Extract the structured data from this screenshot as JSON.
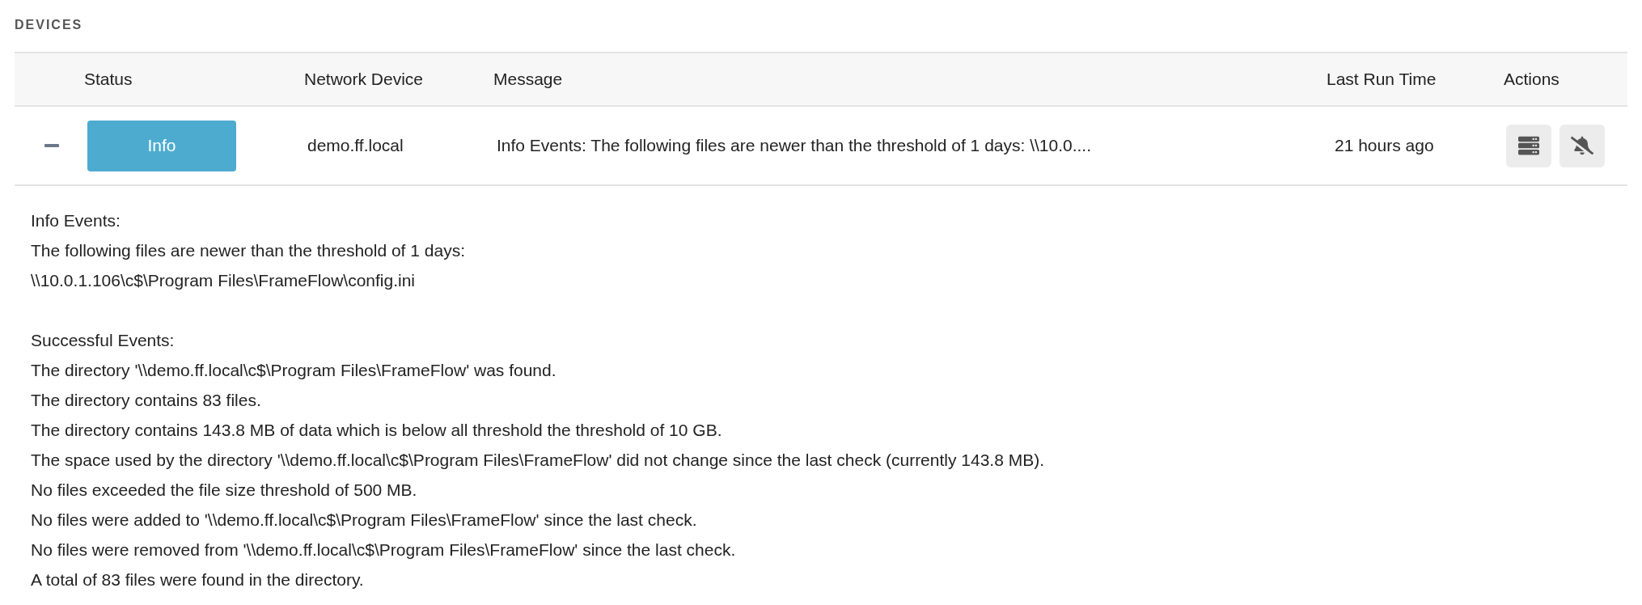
{
  "section_title": "DEVICES",
  "table": {
    "columns": [
      "Status",
      "Network Device",
      "Message",
      "Last Run Time",
      "Actions"
    ],
    "rows": [
      {
        "expanded": true,
        "status": {
          "label": "Info",
          "kind": "info"
        },
        "device": "demo.ff.local",
        "message": "Info Events: The following files are newer than the threshold of 1 days: \\\\10.0....",
        "last_run": "21 hours ago",
        "actions": [
          {
            "kind": "server"
          },
          {
            "kind": "mute"
          }
        ],
        "details": [
          {
            "lines": [
              "Info Events:",
              "The following files are newer than the threshold of 1 days:",
              "\\\\10.0.1.106\\c$\\Program Files\\FrameFlow\\config.ini"
            ]
          },
          {
            "lines": [
              "Successful Events:",
              "The directory '\\\\demo.ff.local\\c$\\Program Files\\FrameFlow' was found.",
              "The directory contains 83 files.",
              "The directory contains 143.8 MB of data which is below all threshold the threshold of 10 GB.",
              "The space used by the directory '\\\\demo.ff.local\\c$\\Program Files\\FrameFlow' did not change since the last check (currently 143.8 MB).",
              "No files exceeded the file size threshold of 500 MB.",
              "No files were added to '\\\\demo.ff.local\\c$\\Program Files\\FrameFlow' since the last check.",
              "No files were removed from '\\\\demo.ff.local\\c$\\Program Files\\FrameFlow' since the last check.",
              "A total of 83 files were found in the directory."
            ]
          }
        ]
      }
    ]
  }
}
